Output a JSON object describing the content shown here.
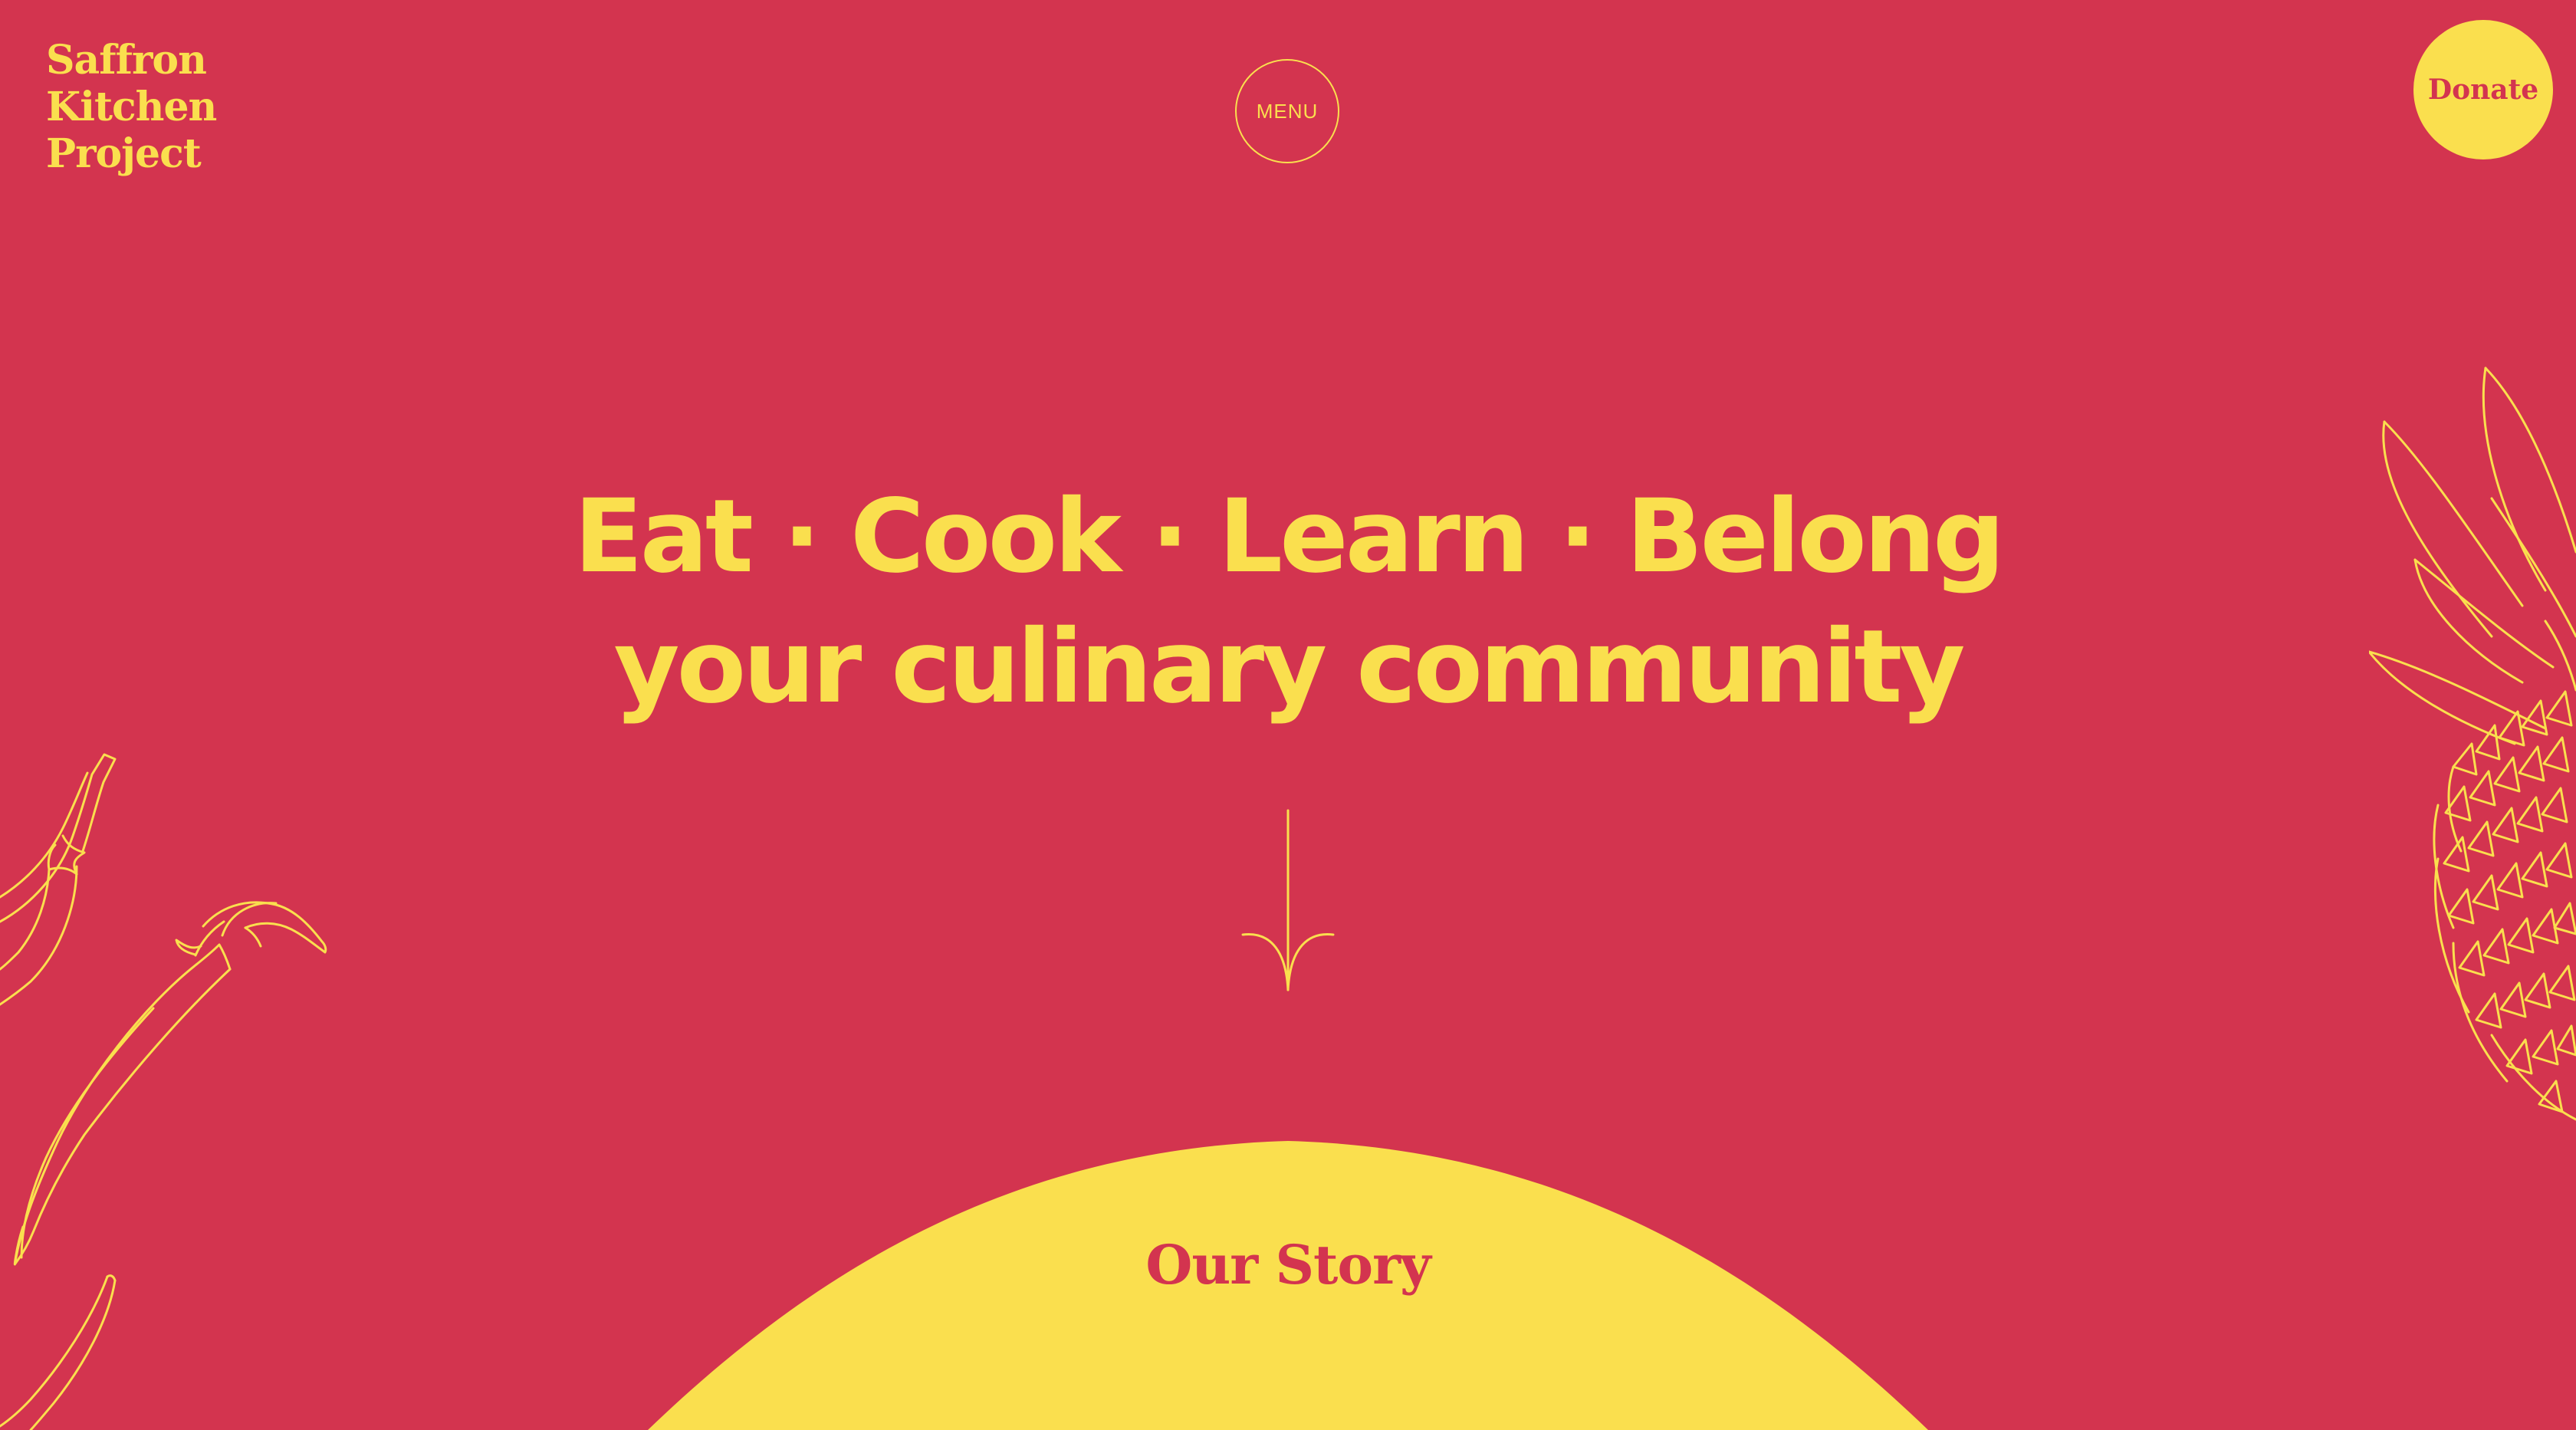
{
  "brand": {
    "logo_lines": [
      "Saffron",
      "Kitchen",
      "Project"
    ]
  },
  "nav": {
    "menu_label": "MENU",
    "donate_label": "Donate"
  },
  "hero": {
    "line1": "Eat · Cook · Learn · Belong",
    "line2": "your culinary community"
  },
  "story": {
    "label": "Our Story"
  },
  "icons": {
    "scroll": "arrow-down-icon",
    "chili": "chili-pepper-illustration",
    "pineapple": "pineapple-illustration"
  },
  "colors": {
    "background": "#D3344F",
    "accent": "#FADF4E"
  }
}
